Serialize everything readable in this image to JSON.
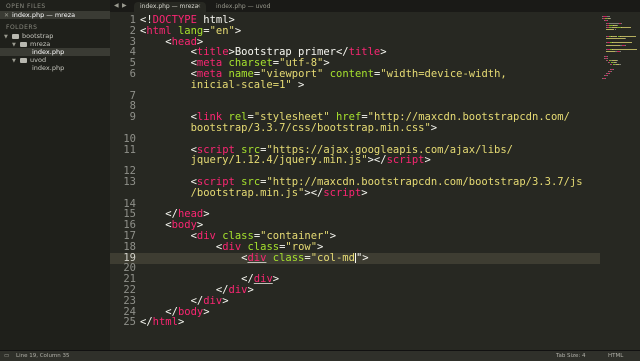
{
  "sidebar": {
    "open_files_header": "OPEN FILES",
    "open_files": [
      {
        "label": "index.php — mreza"
      }
    ],
    "folders_header": "FOLDERS",
    "tree": [
      {
        "label": "bootstrap",
        "kind": "folder",
        "depth": 0
      },
      {
        "label": "mreza",
        "kind": "folder",
        "depth": 1
      },
      {
        "label": "index.php",
        "kind": "file",
        "depth": 2,
        "active": true
      },
      {
        "label": "uvod",
        "kind": "folder",
        "depth": 1
      },
      {
        "label": "index.php",
        "kind": "file",
        "depth": 2,
        "active": false
      }
    ]
  },
  "tabs": [
    {
      "label": "index.php — mreza",
      "active": true
    },
    {
      "label": "index.php — uvod",
      "active": false
    }
  ],
  "editor": {
    "current_line": "19",
    "lines": [
      {
        "n": "1",
        "tokens": [
          {
            "t": "<!",
            "c": "pl"
          },
          {
            "t": "DOCTYPE",
            "c": "tg"
          },
          {
            "t": " html>",
            "c": "pl"
          }
        ]
      },
      {
        "n": "2",
        "tokens": [
          {
            "t": "<",
            "c": "pl"
          },
          {
            "t": "html",
            "c": "tg"
          },
          {
            "t": " ",
            "c": "pl"
          },
          {
            "t": "lang",
            "c": "at"
          },
          {
            "t": "=",
            "c": "pl"
          },
          {
            "t": "\"en\"",
            "c": "st"
          },
          {
            "t": ">",
            "c": "pl"
          }
        ]
      },
      {
        "n": "3",
        "tokens": [
          {
            "t": "    <",
            "c": "pl"
          },
          {
            "t": "head",
            "c": "tg"
          },
          {
            "t": ">",
            "c": "pl"
          }
        ]
      },
      {
        "n": "4",
        "tokens": [
          {
            "t": "        <",
            "c": "pl"
          },
          {
            "t": "title",
            "c": "tg"
          },
          {
            "t": ">Bootstrap primer</",
            "c": "pl"
          },
          {
            "t": "title",
            "c": "tg"
          },
          {
            "t": ">",
            "c": "pl"
          }
        ]
      },
      {
        "n": "5",
        "tokens": [
          {
            "t": "        <",
            "c": "pl"
          },
          {
            "t": "meta",
            "c": "tg"
          },
          {
            "t": " ",
            "c": "pl"
          },
          {
            "t": "charset",
            "c": "at"
          },
          {
            "t": "=",
            "c": "pl"
          },
          {
            "t": "\"utf-8\"",
            "c": "st"
          },
          {
            "t": ">",
            "c": "pl"
          }
        ]
      },
      {
        "n": "6",
        "tokens": [
          {
            "t": "        <",
            "c": "pl"
          },
          {
            "t": "meta",
            "c": "tg"
          },
          {
            "t": " ",
            "c": "pl"
          },
          {
            "t": "name",
            "c": "at"
          },
          {
            "t": "=",
            "c": "pl"
          },
          {
            "t": "\"viewport\"",
            "c": "st"
          },
          {
            "t": " ",
            "c": "pl"
          },
          {
            "t": "content",
            "c": "at"
          },
          {
            "t": "=",
            "c": "pl"
          },
          {
            "t": "\"width=device-width,",
            "c": "st"
          }
        ]
      },
      {
        "n": "",
        "tokens": [
          {
            "t": "        ",
            "c": "pl"
          },
          {
            "t": "inicial-scale=1\"",
            "c": "st"
          },
          {
            "t": " >",
            "c": "pl"
          }
        ]
      },
      {
        "n": "7",
        "tokens": []
      },
      {
        "n": "8",
        "tokens": []
      },
      {
        "n": "9",
        "tokens": [
          {
            "t": "        <",
            "c": "pl"
          },
          {
            "t": "link",
            "c": "tg"
          },
          {
            "t": " ",
            "c": "pl"
          },
          {
            "t": "rel",
            "c": "at"
          },
          {
            "t": "=",
            "c": "pl"
          },
          {
            "t": "\"stylesheet\"",
            "c": "st"
          },
          {
            "t": " ",
            "c": "pl"
          },
          {
            "t": "href",
            "c": "at"
          },
          {
            "t": "=",
            "c": "pl"
          },
          {
            "t": "\"http://maxcdn.bootstrapcdn.com/",
            "c": "st"
          }
        ]
      },
      {
        "n": "",
        "tokens": [
          {
            "t": "        ",
            "c": "pl"
          },
          {
            "t": "bootstrap/3.3.7/css/bootstrap.min.css\"",
            "c": "st"
          },
          {
            "t": ">",
            "c": "pl"
          }
        ]
      },
      {
        "n": "10",
        "tokens": []
      },
      {
        "n": "11",
        "tokens": [
          {
            "t": "        <",
            "c": "pl"
          },
          {
            "t": "script",
            "c": "tg"
          },
          {
            "t": " ",
            "c": "pl"
          },
          {
            "t": "src",
            "c": "at"
          },
          {
            "t": "=",
            "c": "pl"
          },
          {
            "t": "\"https://ajax.googleapis.com/ajax/libs/",
            "c": "st"
          }
        ]
      },
      {
        "n": "",
        "tokens": [
          {
            "t": "        ",
            "c": "pl"
          },
          {
            "t": "jquery/1.12.4/jquery.min.js\"",
            "c": "st"
          },
          {
            "t": "></",
            "c": "pl"
          },
          {
            "t": "script",
            "c": "tg"
          },
          {
            "t": ">",
            "c": "pl"
          }
        ]
      },
      {
        "n": "12",
        "tokens": []
      },
      {
        "n": "13",
        "tokens": [
          {
            "t": "        <",
            "c": "pl"
          },
          {
            "t": "script",
            "c": "tg"
          },
          {
            "t": " ",
            "c": "pl"
          },
          {
            "t": "src",
            "c": "at"
          },
          {
            "t": "=",
            "c": "pl"
          },
          {
            "t": "\"http://maxcdn.bootstrapcdn.com/bootstrap/3.3.7/js",
            "c": "st"
          }
        ]
      },
      {
        "n": "",
        "tokens": [
          {
            "t": "        ",
            "c": "pl"
          },
          {
            "t": "/bootstrap.min.js\"",
            "c": "st"
          },
          {
            "t": "></",
            "c": "pl"
          },
          {
            "t": "script",
            "c": "tg"
          },
          {
            "t": ">",
            "c": "pl"
          }
        ]
      },
      {
        "n": "14",
        "tokens": []
      },
      {
        "n": "15",
        "tokens": [
          {
            "t": "    </",
            "c": "pl"
          },
          {
            "t": "head",
            "c": "tg"
          },
          {
            "t": ">",
            "c": "pl"
          }
        ]
      },
      {
        "n": "16",
        "tokens": [
          {
            "t": "    <",
            "c": "pl"
          },
          {
            "t": "body",
            "c": "tg"
          },
          {
            "t": ">",
            "c": "pl"
          }
        ]
      },
      {
        "n": "17",
        "tokens": [
          {
            "t": "        <",
            "c": "pl"
          },
          {
            "t": "div",
            "c": "tg"
          },
          {
            "t": " ",
            "c": "pl"
          },
          {
            "t": "class",
            "c": "at"
          },
          {
            "t": "=",
            "c": "pl"
          },
          {
            "t": "\"container\"",
            "c": "st"
          },
          {
            "t": ">",
            "c": "pl"
          }
        ]
      },
      {
        "n": "18",
        "tokens": [
          {
            "t": "            <",
            "c": "pl"
          },
          {
            "t": "div",
            "c": "tg"
          },
          {
            "t": " ",
            "c": "pl"
          },
          {
            "t": "class",
            "c": "at"
          },
          {
            "t": "=",
            "c": "pl"
          },
          {
            "t": "\"row\"",
            "c": "st"
          },
          {
            "t": ">",
            "c": "pl"
          }
        ]
      },
      {
        "n": "19",
        "tokens": [
          {
            "t": "                <",
            "c": "pl"
          },
          {
            "t": "div",
            "c": "tg sq"
          },
          {
            "t": " ",
            "c": "pl"
          },
          {
            "t": "class",
            "c": "at"
          },
          {
            "t": "=",
            "c": "pl"
          },
          {
            "t": "\"col-md",
            "c": "st"
          },
          {
            "t": "|",
            "c": "caret"
          },
          {
            "t": "\">",
            "c": "pl"
          }
        ]
      },
      {
        "n": "20",
        "tokens": []
      },
      {
        "n": "21",
        "tokens": [
          {
            "t": "                </",
            "c": "pl"
          },
          {
            "t": "div",
            "c": "tg sq"
          },
          {
            "t": ">",
            "c": "pl"
          }
        ]
      },
      {
        "n": "22",
        "tokens": [
          {
            "t": "            </",
            "c": "pl"
          },
          {
            "t": "div",
            "c": "tg"
          },
          {
            "t": ">",
            "c": "pl"
          }
        ]
      },
      {
        "n": "23",
        "tokens": [
          {
            "t": "        </",
            "c": "pl"
          },
          {
            "t": "div",
            "c": "tg"
          },
          {
            "t": ">",
            "c": "pl"
          }
        ]
      },
      {
        "n": "24",
        "tokens": [
          {
            "t": "    </",
            "c": "pl"
          },
          {
            "t": "body",
            "c": "tg"
          },
          {
            "t": ">",
            "c": "pl"
          }
        ]
      },
      {
        "n": "25",
        "tokens": [
          {
            "t": "</",
            "c": "pl"
          },
          {
            "t": "html",
            "c": "tg"
          },
          {
            "t": ">",
            "c": "pl"
          }
        ]
      }
    ]
  },
  "status": {
    "position": "Line 19, Column 35",
    "tab_size": "Tab Size: 4",
    "syntax": "HTML"
  },
  "icons": {
    "tab_close": "close-icon",
    "tab_scroll_left": "chevron-left-icon",
    "tab_scroll_right": "chevron-right-icon",
    "folder": "folder-icon",
    "disclosure": "triangle-icon"
  },
  "theme": {
    "background": "#272822",
    "tag": "#f92672",
    "attribute": "#a6e22e",
    "string": "#e6db74",
    "text": "#f8f8f2",
    "gutter": "#8f908a"
  }
}
